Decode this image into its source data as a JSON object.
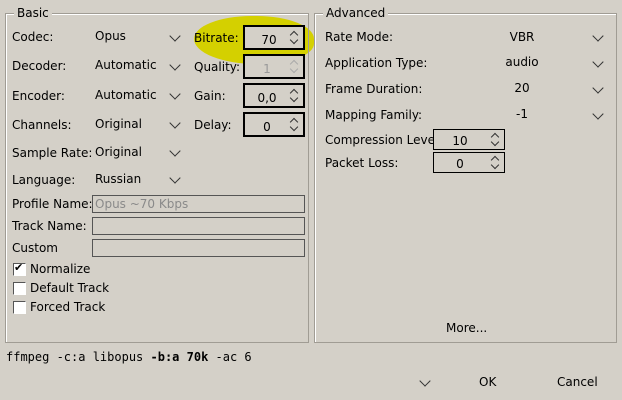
{
  "basic": {
    "title": "Basic",
    "rows": [
      {
        "label": "Codec:",
        "value": "Opus"
      },
      {
        "label": "Decoder:",
        "value": "Automatic"
      },
      {
        "label": "Encoder:",
        "value": "Automatic"
      },
      {
        "label": "Channels:",
        "value": "Original"
      },
      {
        "label": "Sample Rate:",
        "value": "Original"
      },
      {
        "label": "Language:",
        "value": "Russian"
      }
    ],
    "spins": [
      {
        "label": "Bitrate:",
        "value": "70"
      },
      {
        "label": "Quality:",
        "value": "1",
        "disabled": true
      },
      {
        "label": "Gain:",
        "value": "0,0"
      },
      {
        "label": "Delay:",
        "value": "0"
      }
    ],
    "profile_name": {
      "label": "Profile Name:",
      "placeholder": "Opus ~70 Kbps"
    },
    "track_name": {
      "label": "Track Name:",
      "value": ""
    },
    "custom": {
      "label": "Custom",
      "value": ""
    },
    "checkboxes": [
      {
        "label": "Normalize",
        "checked": true
      },
      {
        "label": "Default Track",
        "checked": false
      },
      {
        "label": "Forced Track",
        "checked": false
      }
    ]
  },
  "advanced": {
    "title": "Advanced",
    "rows": [
      {
        "label": "Rate Mode:",
        "value": "VBR"
      },
      {
        "label": "Application Type:",
        "value": "audio"
      },
      {
        "label": "Frame Duration:",
        "value": "20"
      },
      {
        "label": "Mapping Family:",
        "value": "-1"
      }
    ],
    "compression_level": {
      "label": "Compression Level:",
      "value": "10"
    },
    "packet_loss": {
      "label": "Packet Loss:",
      "value": "0"
    },
    "more_label": "More..."
  },
  "command": {
    "prefix": "ffmpeg -c:a libopus ",
    "bold": "-b:a 70k",
    "suffix": " -ac 6"
  },
  "buttons": {
    "ok": "OK",
    "cancel": "Cancel"
  },
  "colors": {
    "background": "#d4d0c8",
    "highlight": "#d4d000"
  }
}
